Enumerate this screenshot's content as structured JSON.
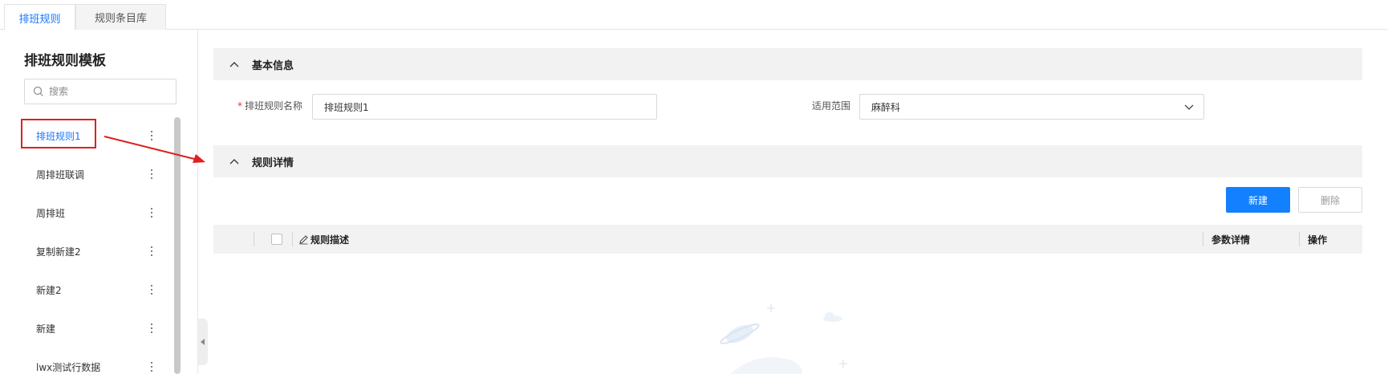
{
  "tabs": [
    {
      "label": "排班规则",
      "active": true
    },
    {
      "label": "规则条目库",
      "active": false
    }
  ],
  "sidebar": {
    "title": "排班规则模板",
    "search_placeholder": "搜索",
    "items": [
      {
        "label": "排班规则1",
        "active": true
      },
      {
        "label": "周排班联调",
        "active": false
      },
      {
        "label": "周排班",
        "active": false
      },
      {
        "label": "复制新建2",
        "active": false
      },
      {
        "label": "新建2",
        "active": false
      },
      {
        "label": "新建",
        "active": false
      },
      {
        "label": "lwx测试行数据",
        "active": false
      }
    ]
  },
  "main": {
    "basic_section": {
      "title": "基本信息",
      "icon": "chevron-up-icon"
    },
    "form": {
      "name_label": "排班规则名称",
      "name_required": "*",
      "name_value": "排班规则1",
      "scope_label": "适用范围",
      "scope_value": "麻醉科"
    },
    "detail_section": {
      "title": "规则详情",
      "icon": "chevron-up-icon"
    },
    "buttons": {
      "new_label": "新建",
      "delete_label": "删除"
    },
    "table": {
      "columns": [
        "规则描述",
        "参数详情",
        "操作"
      ],
      "rows": []
    }
  },
  "colors": {
    "accent": "#1677ff",
    "primary_button": "#1280ff",
    "annotation_red": "#e02020",
    "section_bg": "#f2f2f2"
  }
}
